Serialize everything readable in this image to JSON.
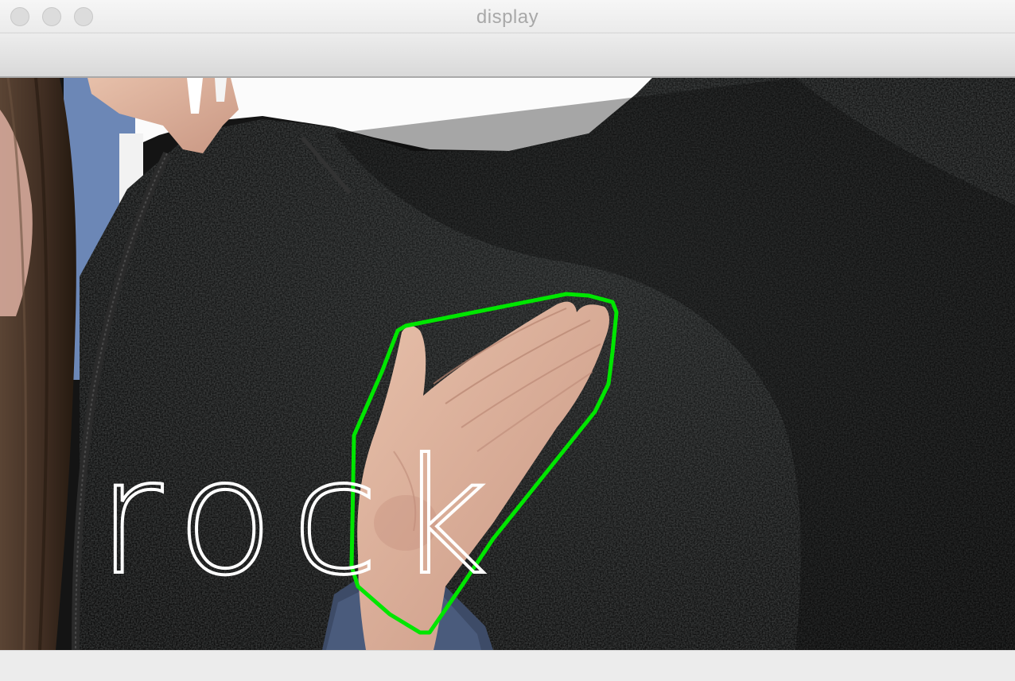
{
  "window": {
    "title": "display"
  },
  "display": {
    "label": "rock",
    "contour_color": "#00e600",
    "label_color": "#ffffff"
  }
}
